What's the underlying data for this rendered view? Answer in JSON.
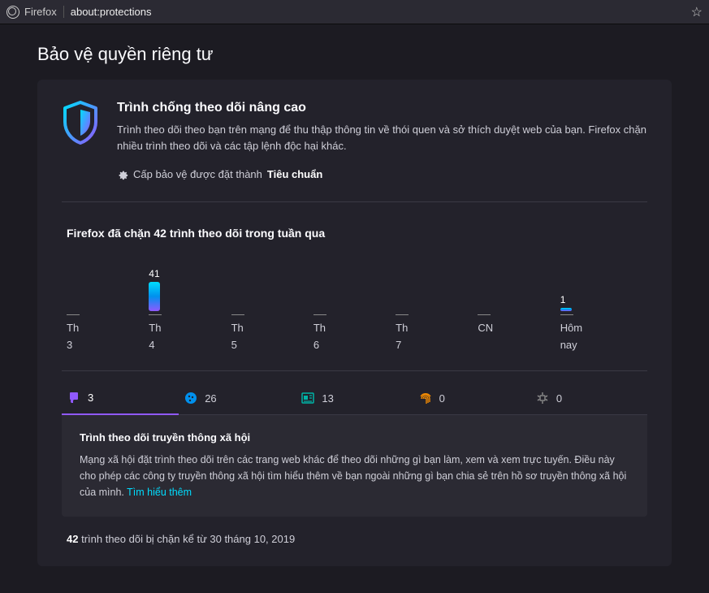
{
  "addressbar": {
    "label": "Firefox",
    "url": "about:protections"
  },
  "page_title": "Bảo vệ quyền riêng tư",
  "hero": {
    "heading": "Trình chống theo dõi nâng cao",
    "body": "Trình theo dõi theo bạn trên mạng để thu thập thông tin về thói quen và sở thích duyệt web của bạn. Firefox chặn nhiều trình theo dõi và các tập lệnh độc hại khác.",
    "level_prefix": "Cấp bảo vệ được đặt thành",
    "level_value": "Tiêu chuẩn"
  },
  "week_summary": "Firefox đã chặn 42 trình theo dõi trong tuần qua",
  "chart_data": {
    "type": "bar",
    "categories": [
      "Th 3",
      "Th 4",
      "Th 5",
      "Th 6",
      "Th 7",
      "CN",
      "Hôm nay"
    ],
    "values": [
      0,
      41,
      0,
      0,
      0,
      0,
      1
    ],
    "ylim": [
      0,
      41
    ]
  },
  "tabs": [
    {
      "id": "social",
      "count": 3,
      "color": "#9059ff",
      "active": true
    },
    {
      "id": "cookie",
      "count": 26,
      "color": "#0090ed",
      "active": false
    },
    {
      "id": "content",
      "count": 13,
      "color": "#00b3a6",
      "active": false
    },
    {
      "id": "fingerprint",
      "count": 0,
      "color": "#ff9100",
      "active": false
    },
    {
      "id": "cryptominer",
      "count": 0,
      "color": "#888",
      "active": false
    }
  ],
  "panel": {
    "heading": "Trình theo dõi truyền thông xã hội",
    "body": "Mạng xã hội đặt trình theo dõi trên các trang web khác để theo dõi những gì bạn làm, xem và xem trực tuyến. Điều này cho phép các công ty truyền thông xã hội tìm hiểu thêm về bạn ngoài những gì bạn chia sẻ trên hồ sơ truyền thông xã hội của mình.",
    "link": "Tìm hiểu thêm"
  },
  "total": {
    "count": "42",
    "text": " trình theo dõi bị chặn kể từ 30 tháng 10, 2019"
  }
}
